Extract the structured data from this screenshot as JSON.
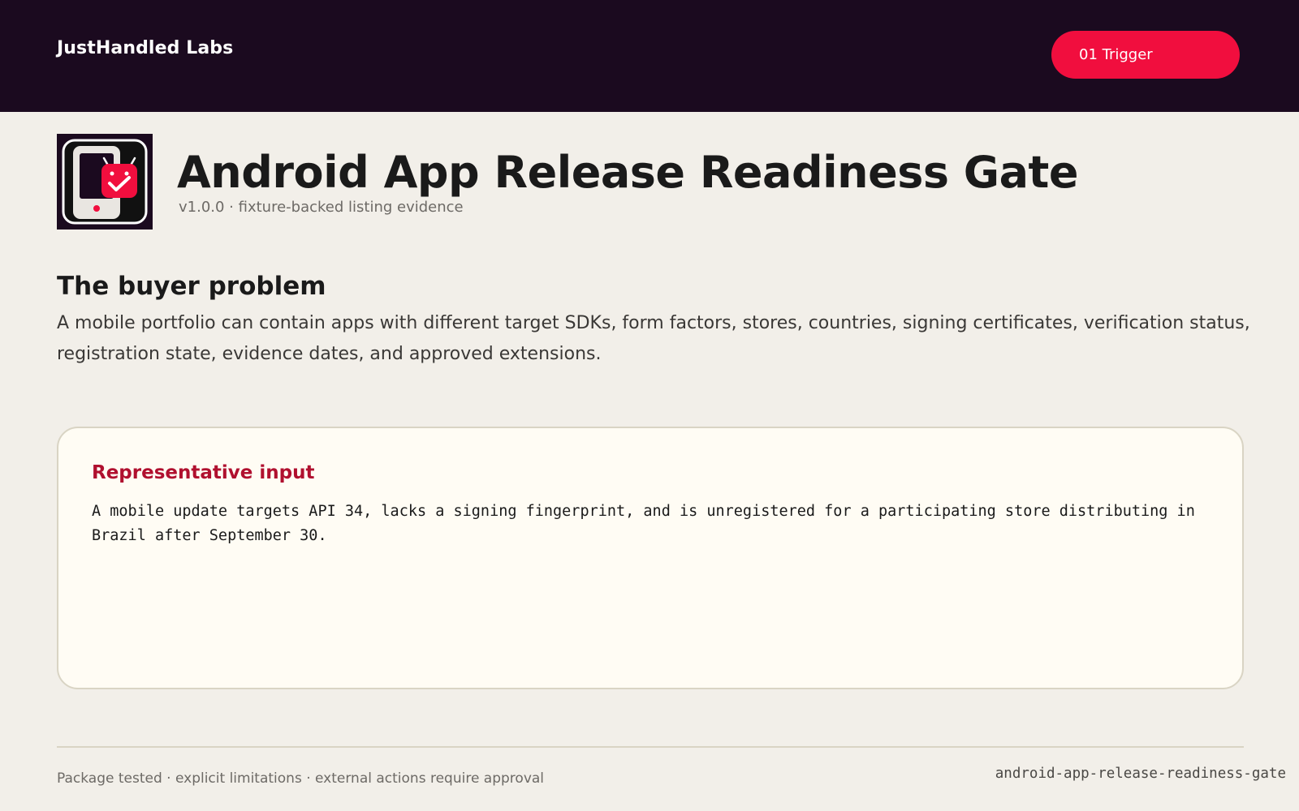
{
  "header": {
    "brand": "JustHandled Labs",
    "trigger_label": "01 Trigger"
  },
  "product": {
    "icon": "phone-checkmark-badge-icon",
    "title": "Android App Release Readiness Gate",
    "subtitle": "v1.0.0 · fixture-backed listing evidence"
  },
  "problem": {
    "heading": "The buyer problem",
    "body": "A mobile portfolio can contain apps with different target SDKs, form factors, stores, countries, signing certificates, verification status, registration state, evidence dates, and approved extensions."
  },
  "input_card": {
    "heading": "Representative input",
    "body": "A mobile update targets API 34, lacks a signing fingerprint, and is unregistered for a participating store distributing in Brazil after September 30."
  },
  "footer": {
    "left": "Package tested · explicit limitations · external actions require approval",
    "slug": "android-app-release-readiness-gate"
  },
  "colors": {
    "header_bg": "#1b0a1f",
    "accent": "#f10e3e",
    "card_title": "#b0102f",
    "page_bg": "#f2efe9"
  }
}
